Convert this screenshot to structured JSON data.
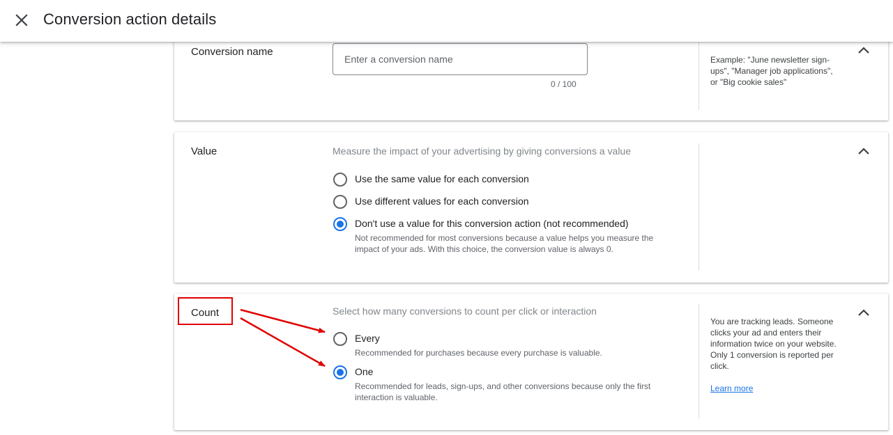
{
  "header": {
    "title": "Conversion action details",
    "close_icon": "close-icon"
  },
  "conversion_name": {
    "label": "Conversion name",
    "input_value": "",
    "input_placeholder": "Enter a conversion name",
    "counter": "0 / 100",
    "help": "Example: \"June newsletter sign-ups\", \"Manager job applications\", or \"Big cookie sales\""
  },
  "value": {
    "label": "Value",
    "description": "Measure the impact of your advertising by giving conversions a value",
    "options": [
      {
        "label": "Use the same value for each conversion",
        "checked": false
      },
      {
        "label": "Use different values for each conversion",
        "checked": false
      },
      {
        "label": "Don't use a value for this conversion action (not recommended)",
        "checked": true,
        "sub": "Not recommended for most conversions because a value helps you measure the impact of your ads. With this choice, the conversion value is always 0."
      }
    ]
  },
  "count": {
    "label": "Count",
    "description": "Select how many conversions to count per click or interaction",
    "options": [
      {
        "label": "Every",
        "checked": false,
        "sub": "Recommended for purchases because every purchase is valuable."
      },
      {
        "label": "One",
        "checked": true,
        "sub": "Recommended for leads, sign-ups, and other conversions because only the first interaction is valuable."
      }
    ],
    "help": "You are tracking leads. Someone clicks your ad and enters their information twice on your website. Only 1 conversion is reported per click.",
    "learn_more": "Learn more"
  },
  "colors": {
    "accent": "#1a73e8",
    "annotation": "#e00000"
  }
}
